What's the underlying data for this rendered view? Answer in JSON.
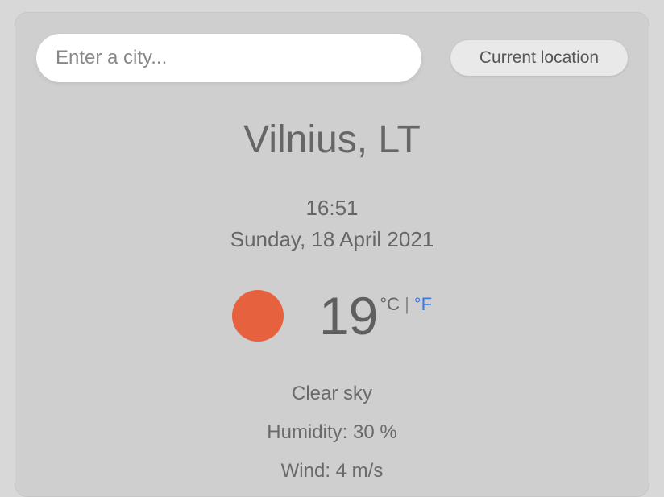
{
  "search": {
    "placeholder": "Enter a city..."
  },
  "buttons": {
    "current_location": "Current location"
  },
  "location": {
    "display": "Vilnius, LT"
  },
  "datetime": {
    "time": "16:51",
    "date": "Sunday, 18 April 2021"
  },
  "weather": {
    "icon_name": "sun-icon",
    "icon_color": "#e6623e",
    "temperature": "19",
    "unit_c": "°C",
    "unit_separator": " | ",
    "unit_f": "°F",
    "description": "Clear sky",
    "humidity_line": "Humidity: 30 %",
    "wind_line": "Wind: 4 m/s"
  }
}
